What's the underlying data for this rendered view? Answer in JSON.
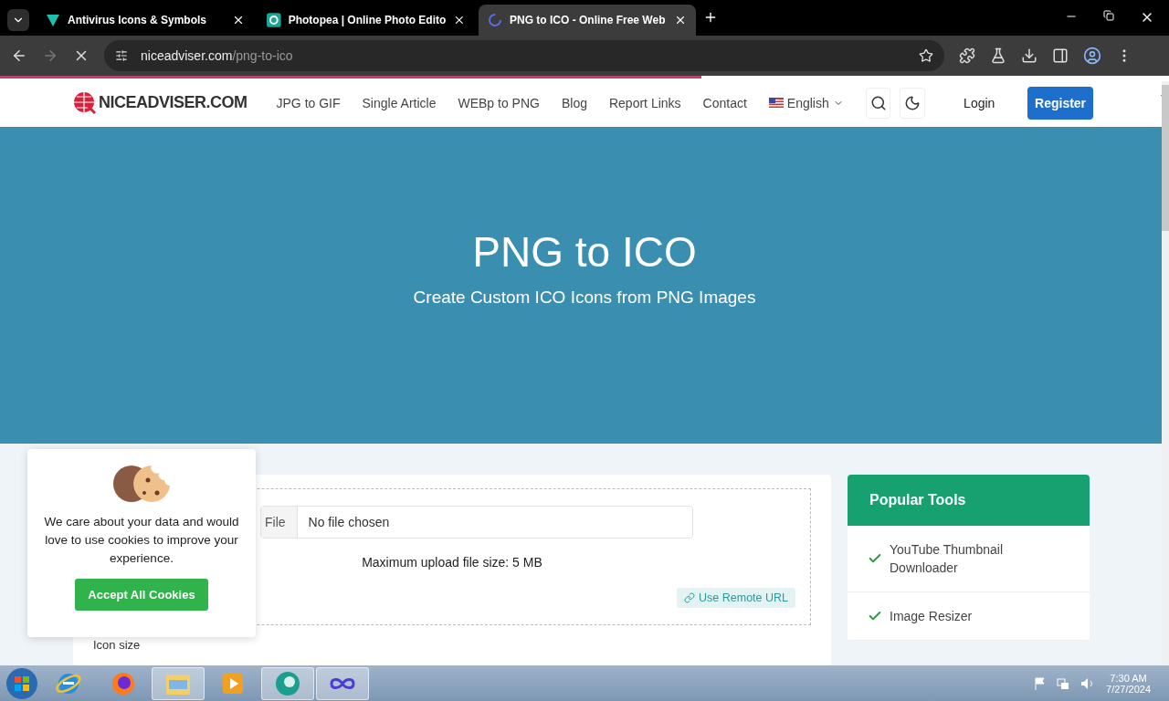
{
  "browser": {
    "tabs": [
      {
        "title": "Antivirus Icons & Symbols",
        "selected": false
      },
      {
        "title": "Photopea | Online Photo Edito",
        "selected": false
      },
      {
        "title": "PNG to ICO - Online Free Web",
        "selected": true
      }
    ],
    "url_host": "niceadviser.com",
    "url_path": "/png-to-ico",
    "loading": {
      "level": 0.6
    }
  },
  "site": {
    "logo": "NICEADVISER.COM",
    "nav": [
      "JPG to GIF",
      "Single Article",
      "WEBp to PNG",
      "Blog",
      "Report Links",
      "Contact"
    ],
    "language": "English",
    "login": "Login",
    "register": "Register"
  },
  "hero": {
    "title": "PNG to ICO",
    "subtitle": "Create Custom ICO Icons from PNG Images"
  },
  "upload": {
    "file_button": "File",
    "file_status": "No file chosen",
    "limit": "Maximum upload file size: 5 MB",
    "remote": "Use Remote URL",
    "icon_size_label": "Icon size"
  },
  "popular": {
    "title": "Popular Tools",
    "items": [
      "YouTube Thumbnail Downloader",
      "Image Resizer"
    ]
  },
  "cookie": {
    "message": "We care about your data and would love to use cookies to improve your experience.",
    "accept": "Accept All Cookies"
  },
  "taskbar": {
    "apps": [
      {
        "kind": "ie",
        "active": false
      },
      {
        "kind": "firefox",
        "active": false
      },
      {
        "kind": "folder",
        "active": true
      },
      {
        "kind": "media",
        "active": false
      },
      {
        "kind": "chrome",
        "active": true
      },
      {
        "kind": "infinity",
        "active": true
      }
    ],
    "time": "7:30 AM",
    "date": "7/27/2024"
  }
}
